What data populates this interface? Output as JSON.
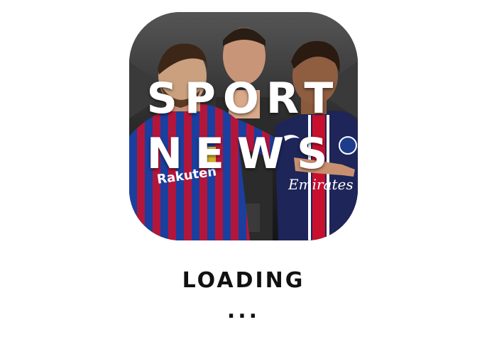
{
  "app_icon": {
    "title_line1": "SPORT",
    "title_line2": "NEWS",
    "shirt_text_left": "Rakuten",
    "shirt_text_right": "Emirates",
    "colors": {
      "barca_blue": "#1a3f9e",
      "barca_red": "#b3163b",
      "psg_navy": "#1d2559",
      "psg_red": "#c8102e",
      "background": "#232323"
    }
  },
  "status": {
    "loading_label": "LOADING",
    "dots": "..."
  }
}
